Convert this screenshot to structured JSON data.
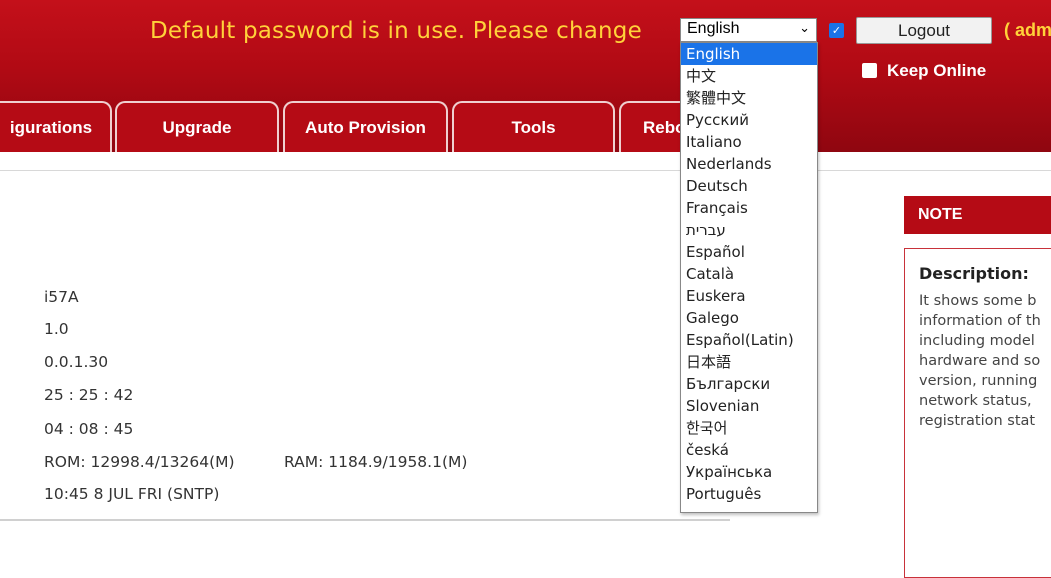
{
  "header": {
    "warning": "Default password is in use. Please change",
    "language_value": "English",
    "logout_label": "Logout",
    "user_partial": "( adm",
    "keep_online_label": "Keep Online"
  },
  "tabs": [
    "igurations",
    "Upgrade",
    "Auto Provision",
    "Tools",
    "Rebo"
  ],
  "info_values": {
    "model": "i57A",
    "hardware": "1.0",
    "software": "0.0.1.30",
    "uptime": "25 : 25 : 42",
    "last_uptime": "04 : 08 : 45",
    "rom": "ROM: 12998.4/13264(M)",
    "ram": "RAM: 1184.9/1958.1(M)",
    "system_time": "10:45 8 JUL FRI (SNTP)"
  },
  "note": {
    "header": "NOTE",
    "title": "Description:",
    "lines": [
      "It shows some b",
      "information of th",
      "including model",
      "hardware and so",
      "version, running",
      "network status,",
      "registration stat"
    ]
  },
  "language_options": [
    "English",
    "中文",
    "繁體中文",
    "Русский",
    "Italiano",
    "Nederlands",
    "Deutsch",
    "Français",
    "עברית",
    "Español",
    "Català",
    "Euskera",
    "Galego",
    "Español(Latin)",
    "日本語",
    "Български",
    "Slovenian",
    "한국어",
    "česká",
    "Українська",
    "Português"
  ],
  "colors": {
    "header_red": "#b50b15",
    "warning_yellow": "#ffd23a",
    "select_blue": "#1a73e8"
  }
}
